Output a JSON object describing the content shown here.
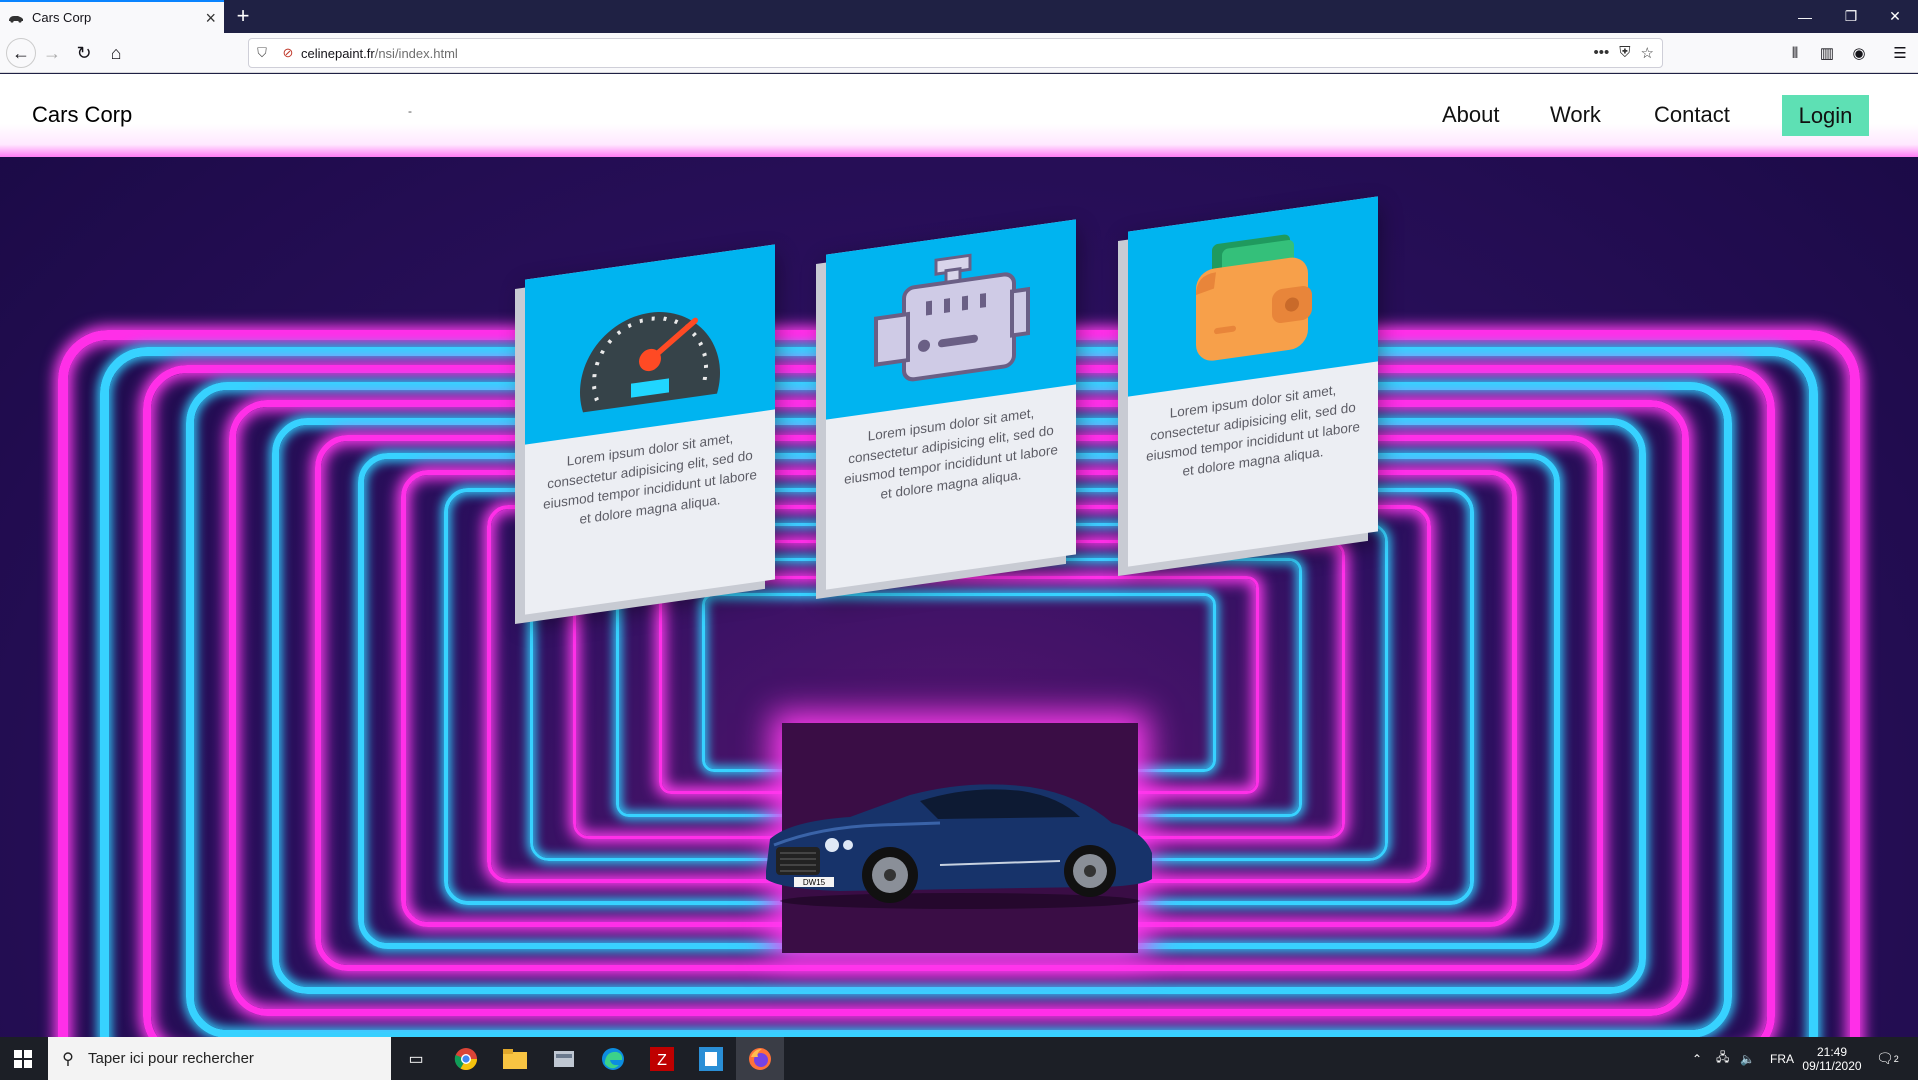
{
  "browser": {
    "tab_title": "Cars Corp",
    "url_host": "celinepaint.fr",
    "url_path": "/nsi/index.html"
  },
  "site": {
    "brand": "Cars Corp",
    "separator": "-",
    "nav": [
      "About",
      "Work",
      "Contact"
    ],
    "login_label": "Login",
    "login_color": "#5ee0b4"
  },
  "cards": [
    {
      "icon": "speedometer-icon",
      "text": "Lorem ipsum dolor sit amet, consectetur adipisicing elit, sed do eiusmod tempor incididunt ut labore et dolore magna aliqua."
    },
    {
      "icon": "engine-icon",
      "text": "Lorem ipsum dolor sit amet, consectetur adipisicing elit, sed do eiusmod tempor incididunt ut labore et dolore magna aliqua."
    },
    {
      "icon": "wallet-icon",
      "text": "Lorem ipsum dolor sit amet, consectetur adipisicing elit, sed do eiusmod tempor incididunt ut labore et dolore magna aliqua."
    }
  ],
  "car": {
    "plate": "DW15"
  },
  "taskbar": {
    "search_placeholder": "Taper ici pour rechercher",
    "language": "FRA",
    "time": "21:49",
    "date": "09/11/2020",
    "notifications": "2"
  },
  "colors": {
    "neon_pink": "#ff2fe8",
    "neon_cyan": "#37d2ff",
    "card_top": "#00b4f0"
  }
}
